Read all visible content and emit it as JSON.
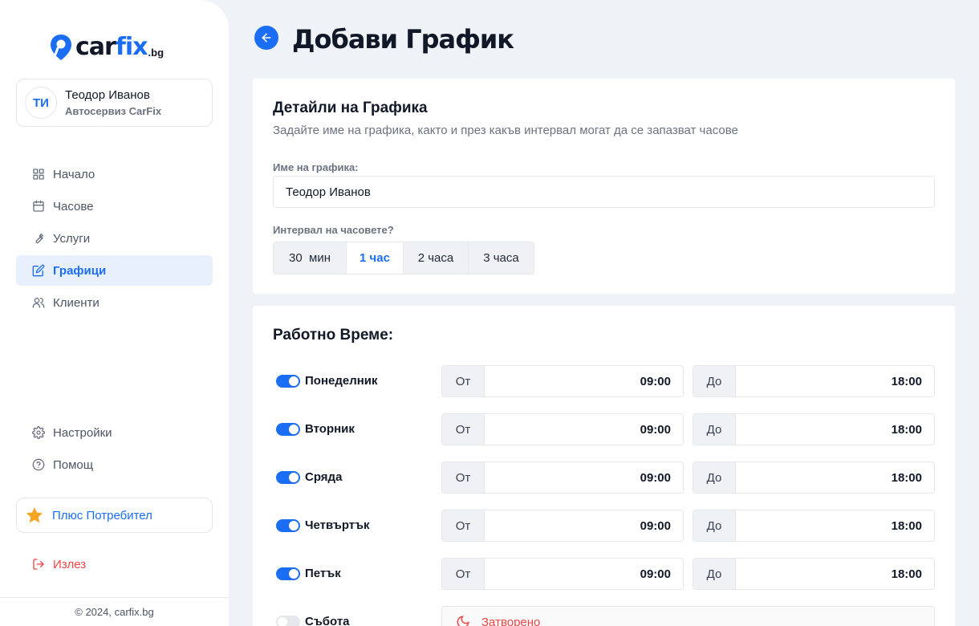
{
  "brand": {
    "logo_car": "car",
    "logo_fix": "fix",
    "logo_tld": ".bg",
    "accent_color": "#1b6ef3"
  },
  "user": {
    "initials": "ТИ",
    "name": "Теодор Иванов",
    "company": "Автосервиз CarFix"
  },
  "nav": {
    "items": [
      {
        "label": "Начало",
        "icon": "grid-icon"
      },
      {
        "label": "Часове",
        "icon": "calendar-icon"
      },
      {
        "label": "Услуги",
        "icon": "wrench-icon"
      },
      {
        "label": "Графици",
        "icon": "edit-icon",
        "active": true
      },
      {
        "label": "Клиенти",
        "icon": "users-icon"
      }
    ],
    "bottom_items": [
      {
        "label": "Настройки",
        "icon": "gear-icon"
      },
      {
        "label": "Помощ",
        "icon": "help-icon"
      }
    ],
    "plus_label": "Плюс Потребител",
    "logout_label": "Излез"
  },
  "footer": {
    "copyright": "© 2024, carfix.bg"
  },
  "header": {
    "title": "Добави График"
  },
  "details": {
    "title": "Детайли на Графика",
    "subtitle": "Задайте име на графика, както и през какъв интервал могат да се запазват часове",
    "name_label": "Име на графика:",
    "name_value": "Теодор Иванов",
    "interval_label": "Интервал на часовете?",
    "intervals": [
      "30  мин",
      "1 час",
      "2 часа",
      "3 часа"
    ],
    "selected_interval": "1 час"
  },
  "hours": {
    "title": "Работно Време:",
    "from_label": "От",
    "to_label": "До",
    "closed_label": "Затворено",
    "days": [
      {
        "name": "Понеделник",
        "enabled": true,
        "from": "09:00",
        "to": "18:00"
      },
      {
        "name": "Вторник",
        "enabled": true,
        "from": "09:00",
        "to": "18:00"
      },
      {
        "name": "Сряда",
        "enabled": true,
        "from": "09:00",
        "to": "18:00"
      },
      {
        "name": "Четвъртък",
        "enabled": true,
        "from": "09:00",
        "to": "18:00"
      },
      {
        "name": "Петък",
        "enabled": true,
        "from": "09:00",
        "to": "18:00"
      },
      {
        "name": "Събота",
        "enabled": false
      }
    ]
  }
}
